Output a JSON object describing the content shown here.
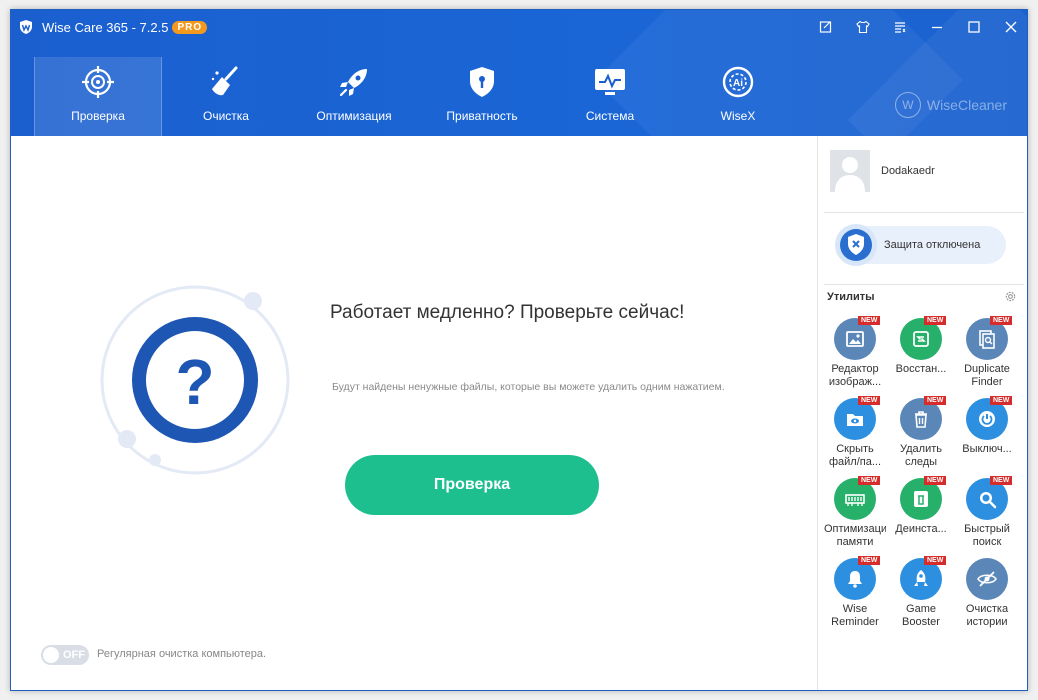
{
  "window": {
    "title": "Wise Care 365 - 7.2.5",
    "edition_badge": "PRO"
  },
  "nav": {
    "items": [
      {
        "label": "Проверка",
        "icon": "crosshair-icon"
      },
      {
        "label": "Очистка",
        "icon": "broom-icon"
      },
      {
        "label": "Оптимизация",
        "icon": "rocket-icon"
      },
      {
        "label": "Приватность",
        "icon": "shield-lock-icon"
      },
      {
        "label": "Система",
        "icon": "monitor-icon"
      },
      {
        "label": "WiseX",
        "icon": "ai-icon"
      }
    ],
    "active_index": 0,
    "brand": "WiseCleaner"
  },
  "main": {
    "headline": "Работает медленно? Проверьте сейчас!",
    "subtext": "Будут найдены ненужные файлы, которые вы можете удалить одним нажатием.",
    "scan_button": "Проверка",
    "toggle_state": "OFF",
    "toggle_text": "Регулярная очистка компьютера."
  },
  "sidebar": {
    "user_name": "Dodakaedr",
    "protection_status": "Защита отключена",
    "utilities_title": "Утилиты",
    "new_badge": "NEW",
    "utilities": [
      {
        "label": "Редактор\nизображ...",
        "icon": "image-editor-icon",
        "color": "#5b86b8",
        "new": true
      },
      {
        "label": "Восстан...",
        "icon": "restore-icon",
        "color": "#27b06a",
        "new": true
      },
      {
        "label": "Duplicate\nFinder",
        "icon": "duplicate-finder-icon",
        "color": "#5b86b8",
        "new": true
      },
      {
        "label": "Скрыть\nфайл/па...",
        "icon": "hide-folder-icon",
        "color": "#2d8fe0",
        "new": true
      },
      {
        "label": "Удалить\nследы",
        "icon": "trash-icon",
        "color": "#5b86b8",
        "new": true
      },
      {
        "label": "Выключ...",
        "icon": "power-icon",
        "color": "#2d8fe0",
        "new": true
      },
      {
        "label": "Оптимизаци\nпамяти",
        "icon": "memory-icon",
        "color": "#27b06a",
        "new": true
      },
      {
        "label": "Деинста...",
        "icon": "uninstall-icon",
        "color": "#27b06a",
        "new": true
      },
      {
        "label": "Быстрый\nпоиск",
        "icon": "search-icon",
        "color": "#2d8fe0",
        "new": true
      },
      {
        "label": "Wise\nReminder",
        "icon": "bell-icon",
        "color": "#2d8fe0",
        "new": true
      },
      {
        "label": "Game\nBooster",
        "icon": "game-rocket-icon",
        "color": "#2d8fe0",
        "new": true
      },
      {
        "label": "Очистка\nистории",
        "icon": "eye-slash-icon",
        "color": "#5b86b8",
        "new": false
      }
    ]
  }
}
